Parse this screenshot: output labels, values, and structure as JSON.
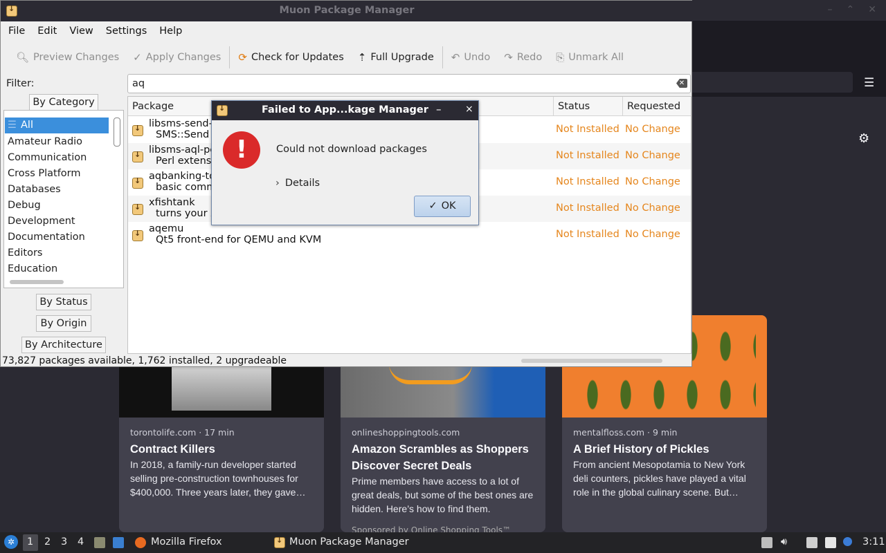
{
  "window": {
    "title": "Muon Package Manager"
  },
  "menu": [
    "File",
    "Edit",
    "View",
    "Settings",
    "Help"
  ],
  "toolbar": {
    "preview": "Preview Changes",
    "apply": "Apply Changes",
    "check": "Check for Updates",
    "upgrade": "Full Upgrade",
    "undo": "Undo",
    "redo": "Redo",
    "unmark": "Unmark All"
  },
  "filter": {
    "label": "Filter:",
    "value": "aq"
  },
  "tabs": {
    "by_category": "By Category",
    "by_status": "By Status",
    "by_origin": "By Origin",
    "by_architecture": "By Architecture"
  },
  "categories": [
    "All",
    "Amateur Radio",
    "Communication",
    "Cross Platform",
    "Databases",
    "Debug",
    "Development",
    "Documentation",
    "Editors",
    "Education"
  ],
  "table": {
    "headers": {
      "package": "Package",
      "status": "Status",
      "requested": "Requested"
    },
    "rows": [
      {
        "name": "libsms-send-a",
        "desc": "SMS::Send d",
        "status": "Not Installed",
        "requested": "No Change"
      },
      {
        "name": "libsms-aql-pe",
        "desc": "Perl extensio",
        "status": "Not Installed",
        "requested": "No Change"
      },
      {
        "name": "aqbanking-to",
        "desc": "basic comma",
        "status": "Not Installed",
        "requested": "No Change"
      },
      {
        "name": "xfishtank",
        "desc": "turns your X",
        "status": "Not Installed",
        "requested": "No Change"
      },
      {
        "name": "aqemu",
        "desc": "Qt5 front-end for QEMU and KVM",
        "status": "Not Installed",
        "requested": "No Change"
      }
    ]
  },
  "statusbar": "73,827 packages available, 1,762 installed, 2 upgradeable",
  "dialog": {
    "title": "Failed to App...kage Manager",
    "minimize": "–",
    "close": "×",
    "message": "Could not download packages",
    "details": "Details",
    "ok": "OK"
  },
  "cards": [
    {
      "meta": "torontolife.com · 17 min",
      "title": "Contract Killers",
      "desc": "In 2018, a family-run developer started selling pre-construction townhouses for $400,000. Three years later, they gave…"
    },
    {
      "meta": "onlineshoppingtools.com",
      "title": "Amazon Scrambles as Shoppers Discover Secret Deals",
      "desc": "Prime members have access to a lot of great deals, but some of the best ones are hidden. Here’s how to find them.",
      "sponsor": "Sponsored by Online Shopping Tools™"
    },
    {
      "meta": "mentalfloss.com · 9 min",
      "title": "A Brief History of Pickles",
      "desc": "From ancient Mesopotamia to New York deli counters, pickles have played a vital role in the global culinary scene. But…"
    }
  ],
  "taskbar": {
    "workspaces": [
      "1",
      "2",
      "3",
      "4"
    ],
    "firefox": "Mozilla Firefox",
    "muon": "Muon Package Manager",
    "clock": "3:11"
  },
  "colors": {
    "status_orange": "#e5861d",
    "selection_blue": "#3b8fdc",
    "error_red": "#da2a2a"
  }
}
